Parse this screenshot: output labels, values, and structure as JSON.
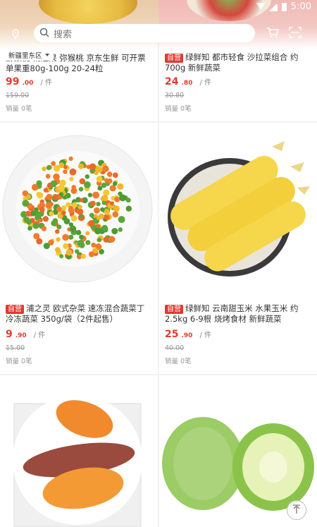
{
  "status_bar": {
    "time": "5:00"
  },
  "search": {
    "placeholder": "搜索"
  },
  "location": {
    "district": "新疆里东区"
  },
  "products": [
    {
      "title": "猕猴桃 精选果 弥猴桃 京东生鲜 可开票 单果重80g-100g 20-24粒",
      "tag": "",
      "price_int": "99",
      "price_dec": ".00",
      "unit": "/ 件",
      "original_price": "159.00",
      "sales": "销量 0笔"
    },
    {
      "title": "绿鲜知 都市轻食 沙拉菜组合 约700g 新鲜蔬菜",
      "tag": "自营",
      "price_int": "24",
      "price_dec": ".80",
      "unit": "/ 件",
      "original_price": "30.80",
      "sales": "销量 0笔"
    },
    {
      "title": "浦之灵 欧式杂菜 速冻混合蔬菜丁 冷冻蔬菜 350g/袋（2件起售）",
      "tag": "自营",
      "price_int": "9",
      "price_dec": ".90",
      "unit": "/ 件",
      "original_price": "15.00",
      "sales": "销量 0笔"
    },
    {
      "title": "绿鲜知 云南甜玉米 水果玉米 约2.5kg 6-9根 烧烤食材 新鲜蔬菜",
      "tag": "自营",
      "price_int": "25",
      "price_dec": ".90",
      "unit": "/ 件",
      "original_price": "40.00",
      "sales": "销量 0笔"
    }
  ],
  "colors": {
    "price": "#e03a2f",
    "tag_bg": "#e03a2f"
  },
  "icons": [
    "location-pin-icon",
    "search-icon",
    "cart-icon",
    "scan-icon",
    "scroll-to-top-icon"
  ]
}
